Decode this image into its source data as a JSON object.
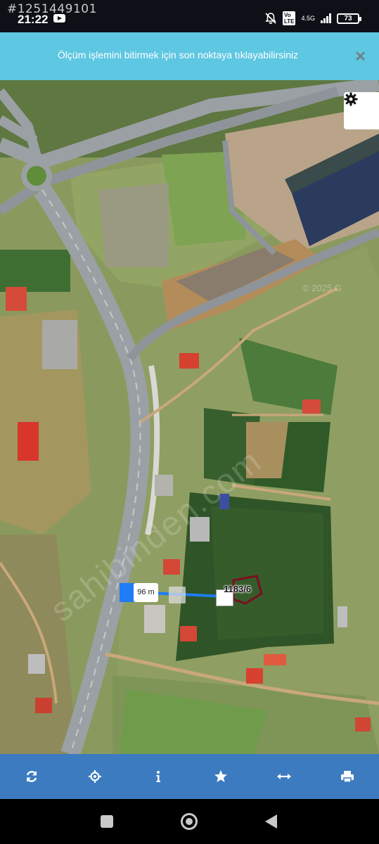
{
  "status_bar": {
    "overlay_id": "#1251449101",
    "time": "21:22",
    "network": "4.5G",
    "battery": "73"
  },
  "banner": {
    "message": "Ölçüm işlemini bitirmek için son noktaya tıklayabilirsiniz"
  },
  "map": {
    "measurement_label": "96 m",
    "parcel_label": "1183/6",
    "watermark": "sahibinden.com",
    "imagery_credit": "© 2025 G"
  },
  "toolbar": {
    "icons": [
      "refresh-icon",
      "locate-icon",
      "info-icon",
      "star-icon",
      "measure-icon",
      "print-icon"
    ]
  },
  "colors": {
    "banner": "#5ec7e2",
    "toolbar": "#3d7bc1",
    "measure_line": "#1f7cf5",
    "parcel_outline": "#7a1020"
  }
}
